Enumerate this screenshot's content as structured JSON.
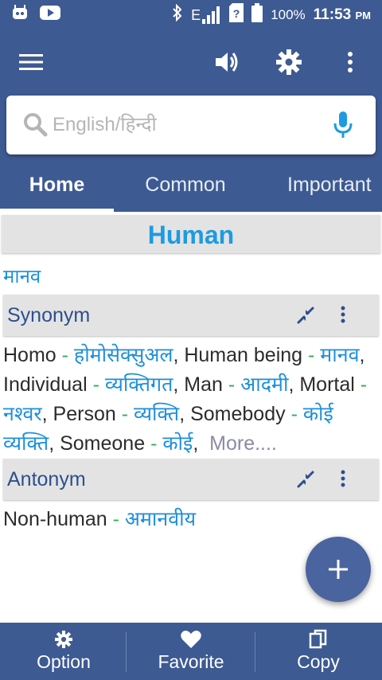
{
  "status_bar": {
    "battery": "100%",
    "time": "11:53",
    "ampm": "PM",
    "network": "E"
  },
  "search": {
    "placeholder": "English/हिन्दी"
  },
  "tabs": [
    {
      "label": "Home"
    },
    {
      "label": "Common"
    },
    {
      "label": "Important"
    }
  ],
  "word": {
    "title": "Human",
    "translation": "मानव"
  },
  "synonym_section": {
    "title": "Synonym",
    "entries": [
      {
        "en": "Homo",
        "hi": "होमोसेक्सुअल"
      },
      {
        "en": "Human being",
        "hi": "मानव"
      },
      {
        "en": "Individual",
        "hi": "व्यक्तिगत"
      },
      {
        "en": "Man",
        "hi": "आदमी"
      },
      {
        "en": "Mortal",
        "hi": "नश्वर"
      },
      {
        "en": "Person",
        "hi": "व्यक्ति"
      },
      {
        "en": "Somebody",
        "hi": "कोई व्यक्ति"
      },
      {
        "en": "Someone",
        "hi": "कोई"
      }
    ],
    "more_label": "More...."
  },
  "antonym_section": {
    "title": "Antonym",
    "entries": [
      {
        "en": "Non-human",
        "hi": "अमानवीय"
      }
    ]
  },
  "bottom_nav": {
    "option": "Option",
    "favorite": "Favorite",
    "copy": "Copy"
  },
  "colors": {
    "primary": "#3d5a92",
    "accent_blue": "#1e9be0",
    "dash_green": "#2fb35a",
    "section_bg": "#e3e3e3"
  }
}
